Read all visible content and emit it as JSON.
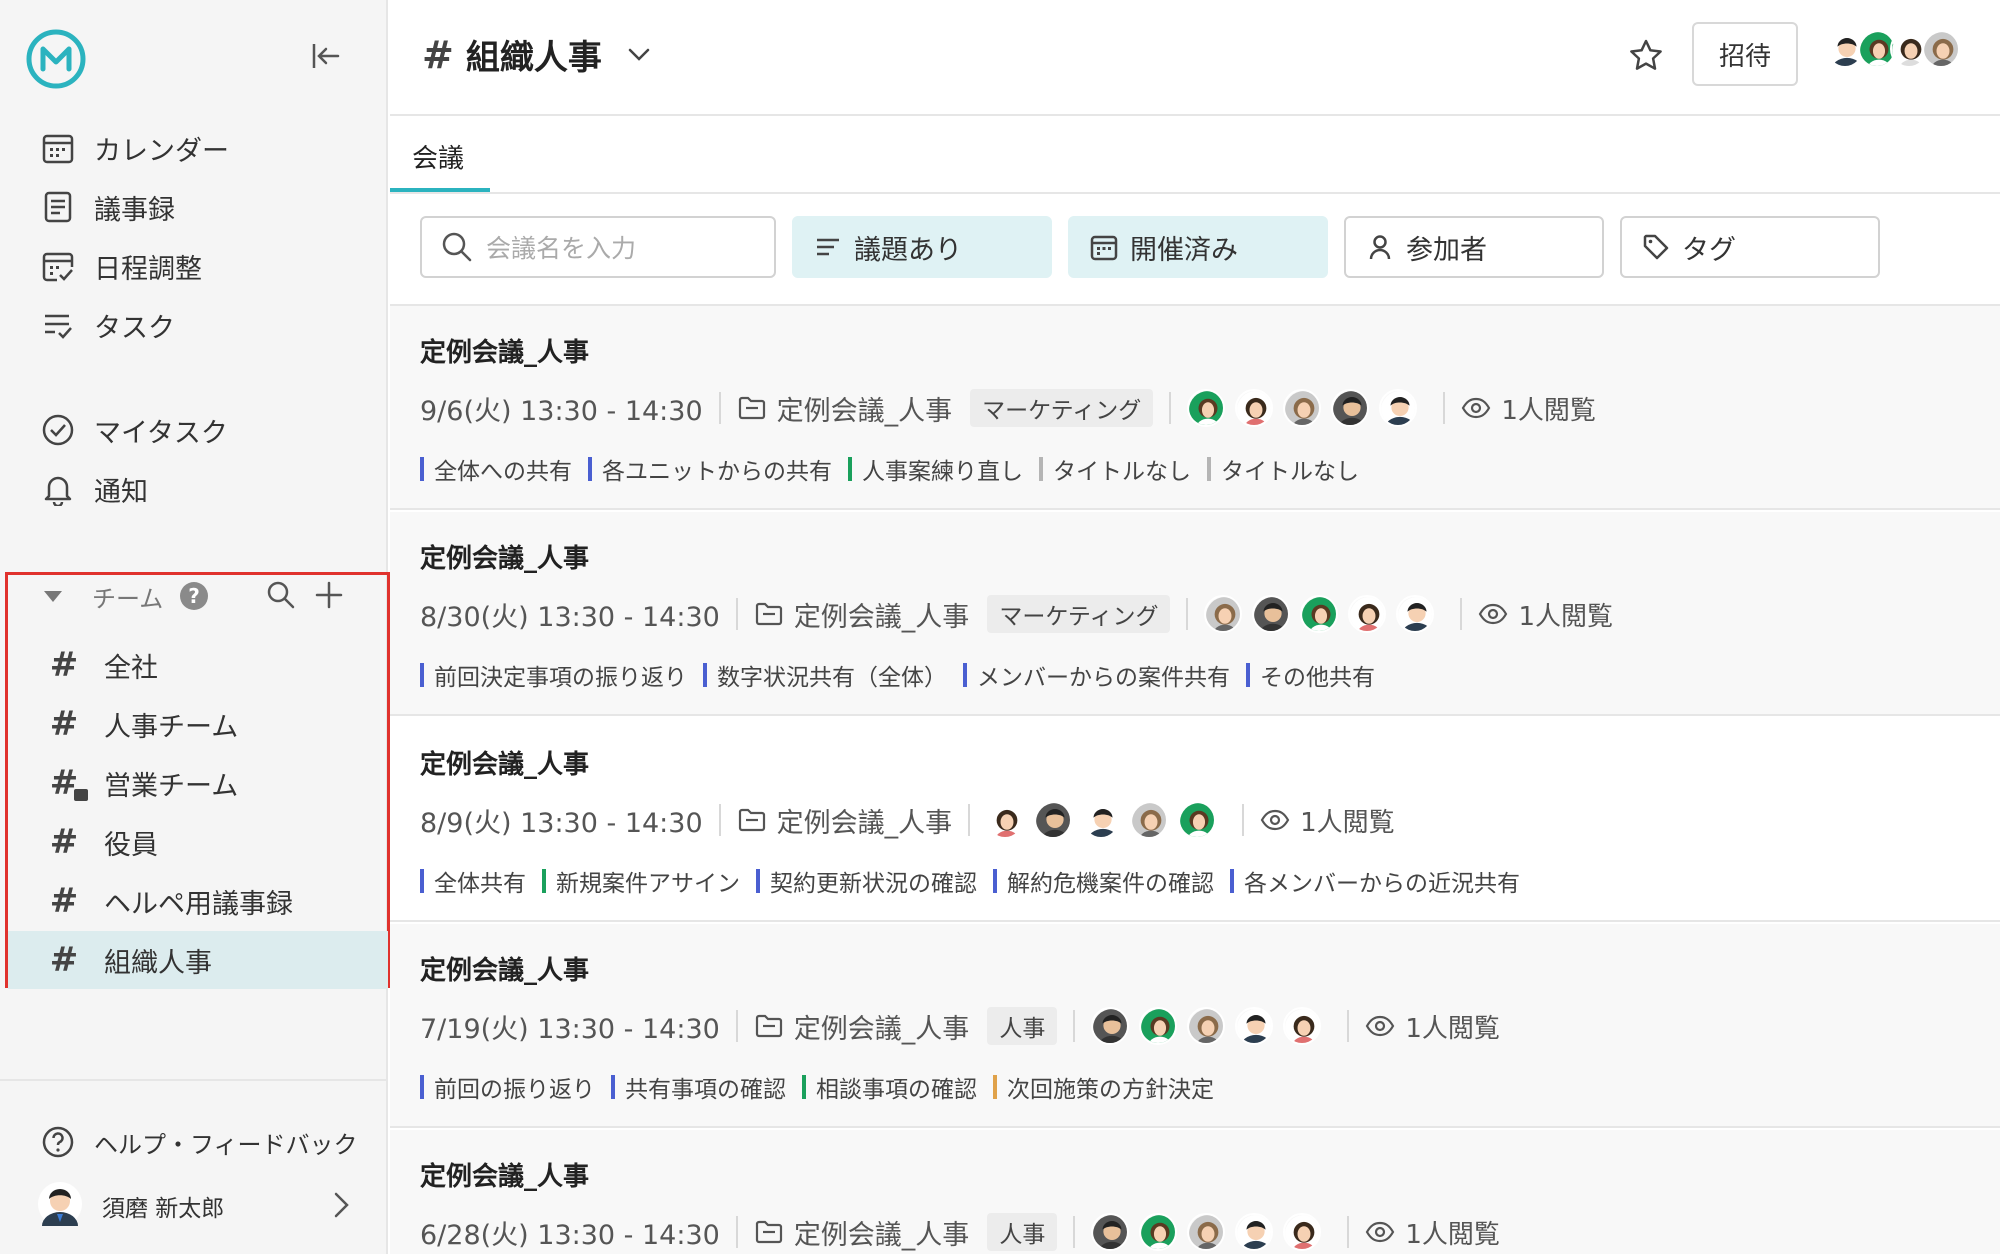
{
  "colors": {
    "accent": "#2bb3bf",
    "highlight": "#e0322d",
    "blue": "#4a5fd1",
    "green": "#1aa05c",
    "gray": "#b5b5b5",
    "orange": "#e0a24a"
  },
  "sidebar": {
    "nav": [
      {
        "label": "カレンダー",
        "icon": "calendar-icon"
      },
      {
        "label": "議事録",
        "icon": "document-icon"
      },
      {
        "label": "日程調整",
        "icon": "calendar-check-icon"
      },
      {
        "label": "タスク",
        "icon": "task-list-icon"
      },
      {
        "label": "マイタスク",
        "icon": "check-circle-icon"
      },
      {
        "label": "通知",
        "icon": "bell-icon"
      }
    ],
    "team_section": {
      "label": "チーム",
      "help": "?"
    },
    "teams": [
      {
        "label": "全社"
      },
      {
        "label": "人事チーム"
      },
      {
        "label": "営業チーム"
      },
      {
        "label": "役員"
      },
      {
        "label": "ヘルペ用議事録"
      },
      {
        "label": "組織人事"
      }
    ],
    "help_label": "ヘルプ・フィードバック",
    "user_name": "須磨 新太郎"
  },
  "header": {
    "hash": "#",
    "channel": "組織人事",
    "invite_label": "招待"
  },
  "tabs": [
    {
      "label": "会議"
    }
  ],
  "filters": {
    "search_placeholder": "会議名を入力",
    "chips": [
      {
        "label": "議題あり",
        "active": true
      },
      {
        "label": "開催済み",
        "active": true
      },
      {
        "label": "参加者",
        "active": false
      },
      {
        "label": "タグ",
        "active": false
      }
    ]
  },
  "meetings": [
    {
      "title": "定例会議_人事",
      "datetime": "9/6(火) 13:30 - 14:30",
      "folder": "定例会議_人事",
      "tag": "マーケティング",
      "views": "1人閲覧",
      "agenda": [
        {
          "text": "全体への共有",
          "color": "#4a5fd1"
        },
        {
          "text": "各ユニットからの共有",
          "color": "#4a5fd1"
        },
        {
          "text": "人事案練り直し",
          "color": "#1aa05c"
        },
        {
          "text": "タイトルなし",
          "color": "#b5b5b5"
        },
        {
          "text": "タイトルなし",
          "color": "#b5b5b5"
        }
      ]
    },
    {
      "title": "定例会議_人事",
      "datetime": "8/30(火) 13:30 - 14:30",
      "folder": "定例会議_人事",
      "tag": "マーケティング",
      "views": "1人閲覧",
      "agenda": [
        {
          "text": "前回決定事項の振り返り",
          "color": "#4a5fd1"
        },
        {
          "text": "数字状況共有（全体）",
          "color": "#4a5fd1"
        },
        {
          "text": "メンバーからの案件共有",
          "color": "#4a5fd1"
        },
        {
          "text": "その他共有",
          "color": "#4a5fd1"
        }
      ]
    },
    {
      "title": "定例会議_人事",
      "datetime": "8/9(火) 13:30 - 14:30",
      "folder": "定例会議_人事",
      "tag": "",
      "views": "1人閲覧",
      "agenda": [
        {
          "text": "全体共有",
          "color": "#4a5fd1"
        },
        {
          "text": "新規案件アサイン",
          "color": "#1aa05c"
        },
        {
          "text": "契約更新状況の確認",
          "color": "#4a5fd1"
        },
        {
          "text": "解約危機案件の確認",
          "color": "#4a5fd1"
        },
        {
          "text": "各メンバーからの近況共有",
          "color": "#4a5fd1"
        }
      ]
    },
    {
      "title": "定例会議_人事",
      "datetime": "7/19(火) 13:30 - 14:30",
      "folder": "定例会議_人事",
      "tag": "人事",
      "views": "1人閲覧",
      "agenda": [
        {
          "text": "前回の振り返り",
          "color": "#4a5fd1"
        },
        {
          "text": "共有事項の確認",
          "color": "#4a5fd1"
        },
        {
          "text": "相談事項の確認",
          "color": "#1aa05c"
        },
        {
          "text": "次回施策の方針決定",
          "color": "#e0a24a"
        }
      ]
    },
    {
      "title": "定例会議_人事",
      "datetime": "6/28(火) 13:30 - 14:30",
      "folder": "定例会議_人事",
      "tag": "人事",
      "views": "1人閲覧",
      "agenda": []
    }
  ]
}
